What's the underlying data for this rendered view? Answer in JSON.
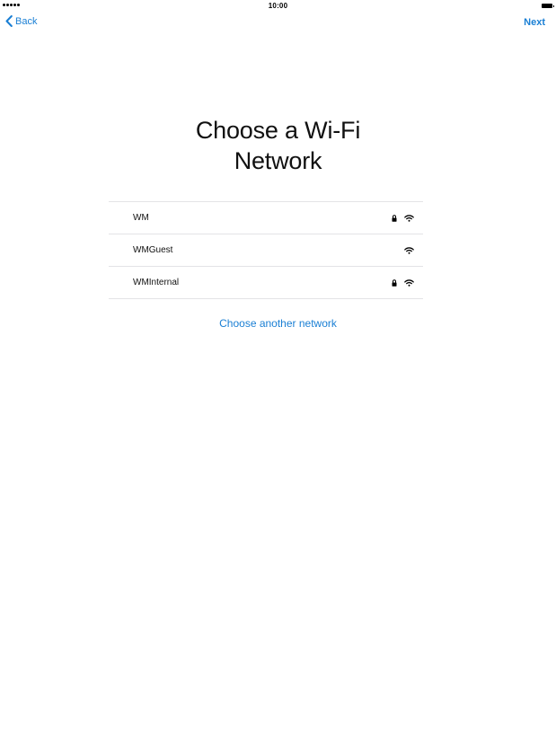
{
  "status_bar": {
    "time": "10:00",
    "signal_icon": "signal-dots-icon",
    "battery_icon": "battery-icon"
  },
  "nav": {
    "back_label": "Back",
    "next_label": "Next",
    "back_icon": "chevron-left-icon"
  },
  "title": {
    "line1": "Choose a Wi-Fi",
    "line2": "Network"
  },
  "networks": [
    {
      "name": "WM",
      "secured": true
    },
    {
      "name": "WMGuest",
      "secured": false
    },
    {
      "name": "WMInternal",
      "secured": true
    }
  ],
  "other_network_label": "Choose another network",
  "colors": {
    "accent": "#1a7fd4",
    "divider": "#e3e3e6"
  }
}
